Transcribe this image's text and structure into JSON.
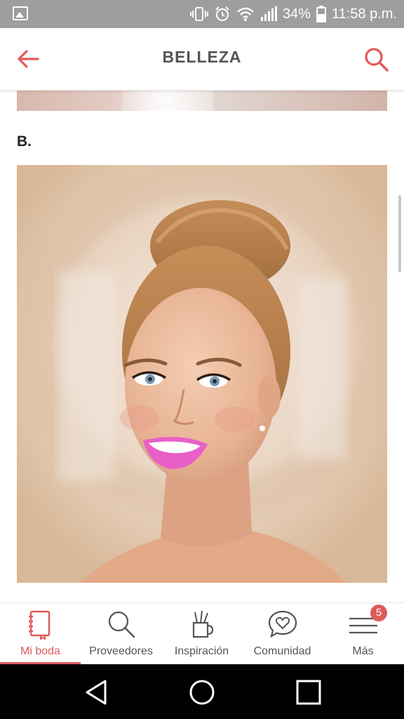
{
  "status_bar": {
    "battery_text": "34%",
    "time": "11:58 p.m."
  },
  "app_bar": {
    "title": "BELLEZA"
  },
  "content": {
    "section_label": "B."
  },
  "bottom_nav": {
    "items": [
      {
        "label": "Mi boda",
        "icon": "notebook-icon",
        "active": true
      },
      {
        "label": "Proveedores",
        "icon": "magnifier-icon",
        "active": false
      },
      {
        "label": "Inspiración",
        "icon": "pencil-cup-icon",
        "active": false
      },
      {
        "label": "Comunidad",
        "icon": "heart-chat-icon",
        "active": false
      },
      {
        "label": "Más",
        "icon": "menu-icon",
        "active": false,
        "badge": "5"
      }
    ]
  },
  "colors": {
    "accent": "#e05a5a",
    "status_bar": "#9e9e9e",
    "system_nav": "#000000"
  }
}
